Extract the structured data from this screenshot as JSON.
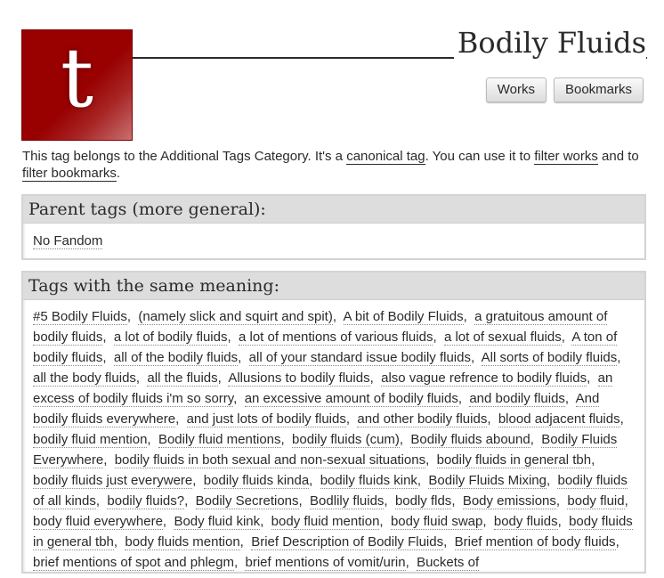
{
  "header": {
    "logo_letter": "t",
    "title": "Bodily Fluids",
    "nav_buttons": [
      "Works",
      "Bookmarks"
    ]
  },
  "intro": {
    "text_1": "This tag belongs to the Additional Tags Category. It's a ",
    "link_canonical": "canonical tag",
    "text_2": ". You can use it to ",
    "link_filter_works": "filter works",
    "text_3": " and to ",
    "link_filter_bookmarks": "filter bookmarks",
    "text_4": "."
  },
  "parent_tags": {
    "heading": "Parent tags (more general):",
    "items": [
      "No Fandom"
    ]
  },
  "synonyms": {
    "heading": "Tags with the same meaning:",
    "items": [
      "#5 Bodily Fluids",
      "(namely slick and squirt and spit)",
      "A bit of Bodily Fluids",
      "a gratuitous amount of bodily fluids",
      "a lot of bodily fluids",
      "a lot of mentions of various fluids",
      "a lot of sexual fluids",
      "A ton of bodily fluids",
      "all of the bodily fluids",
      "all of your standard issue bodily fluids",
      "All sorts of bodily fluids",
      "all the body fluids",
      "all the fluids",
      "Allusions to bodily fluids",
      "also vague refrence to bodily fluids",
      "an excess of bodily fluids i'm so sorry",
      "an excessive amount of bodily fluids",
      "and bodily fluids",
      "And bodily fluids everywhere",
      "and just lots of bodily fluids",
      "and other bodily fluids",
      "blood adjacent fluids",
      "bodily fluid mention",
      "Bodily fluid mentions",
      "bodily fluids (cum)",
      "Bodily fluids abound",
      "Bodily Fluids Everywhere",
      "bodily fluids in both sexual and non-sexual situations",
      "bodily fluids in general tbh",
      "bodily fluids just everywere",
      "bodily fluids kinda",
      "bodily fluids kink",
      "Bodily Fluids Mixing",
      "bodily fluids of all kinds",
      "bodily fluids?",
      "Bodily Secretions",
      "Bodlily fluids",
      "bodly flds",
      "Body emissions",
      "body fluid",
      "body fluid everywhere",
      "Body fluid kink",
      "body fluid mention",
      "body fluid swap",
      "body fluids",
      "body fluids in general tbh",
      "body fluids mention",
      "Brief Description of Bodily Fluids",
      "Brief mention of body fluids",
      "brief mentions of spot and phlegm",
      "brief mentions of vomit/urin",
      "Buckets of"
    ]
  }
}
